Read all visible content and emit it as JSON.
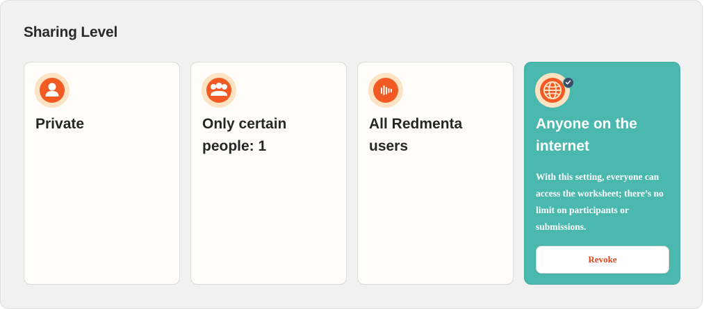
{
  "panel": {
    "title": "Sharing Level"
  },
  "options": [
    {
      "label": "Private",
      "icon": "person-icon",
      "selected": false
    },
    {
      "label": "Only certain people: 1",
      "icon": "group-icon",
      "selected": false
    },
    {
      "label": "All Redmenta users",
      "icon": "redmenta-logo-icon",
      "selected": false
    },
    {
      "label": "Anyone on the internet",
      "icon": "globe-icon",
      "selected": true,
      "description": "With this setting, everyone can access the worksheet; there’s no limit on participants or submissions.",
      "action_label": "Revoke"
    }
  ],
  "colors": {
    "accent": "#f15a22",
    "icon_bg": "#fbe3c4",
    "selected_card": "#4ab8ae",
    "check_badge": "#3d4c66",
    "revoke_text": "#e0461a"
  }
}
